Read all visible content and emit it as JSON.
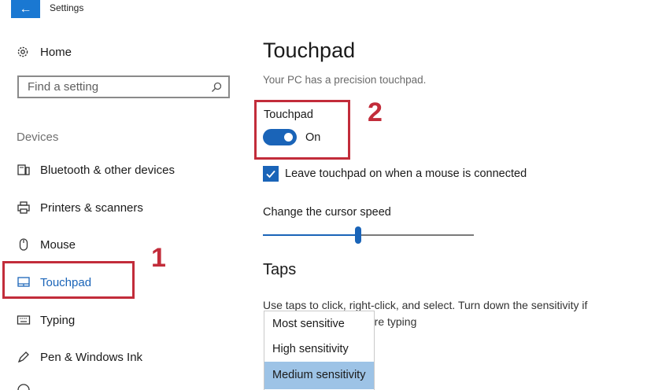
{
  "window": {
    "title": "Settings",
    "back_glyph": "←"
  },
  "sidebar": {
    "home_label": "Home",
    "search_placeholder": "Find a setting",
    "section_label": "Devices",
    "items": [
      {
        "label": "Bluetooth & other devices",
        "icon": "bluetooth-devices-icon"
      },
      {
        "label": "Printers & scanners",
        "icon": "printer-icon"
      },
      {
        "label": "Mouse",
        "icon": "mouse-icon"
      },
      {
        "label": "Touchpad",
        "icon": "touchpad-icon",
        "active": true
      },
      {
        "label": "Typing",
        "icon": "keyboard-icon"
      },
      {
        "label": "Pen & Windows Ink",
        "icon": "pen-icon"
      }
    ]
  },
  "annotations": {
    "callout_1": "1",
    "callout_2": "2"
  },
  "main": {
    "title": "Touchpad",
    "subtitle": "Your PC has a precision touchpad.",
    "toggle": {
      "label": "Touchpad",
      "state": "On",
      "on": true
    },
    "checkbox": {
      "label": "Leave touchpad on when a mouse is connected",
      "checked": true
    },
    "cursor_speed": {
      "label": "Change the cursor speed",
      "value_fraction": 0.45
    },
    "taps": {
      "heading": "Taps",
      "desc_line1": "Use taps to click, right-click, and select. Turn down the sensitivity if",
      "desc_line2_visible": "'re typing"
    },
    "sensitivity_dropdown": {
      "options": [
        "Most sensitive",
        "High sensitivity",
        "Medium sensitivity"
      ],
      "selected": "Medium sensitivity"
    }
  },
  "colors": {
    "accent": "#1a64b8",
    "annotation": "#c22c3a",
    "selected_option": "#9dc3e6"
  }
}
